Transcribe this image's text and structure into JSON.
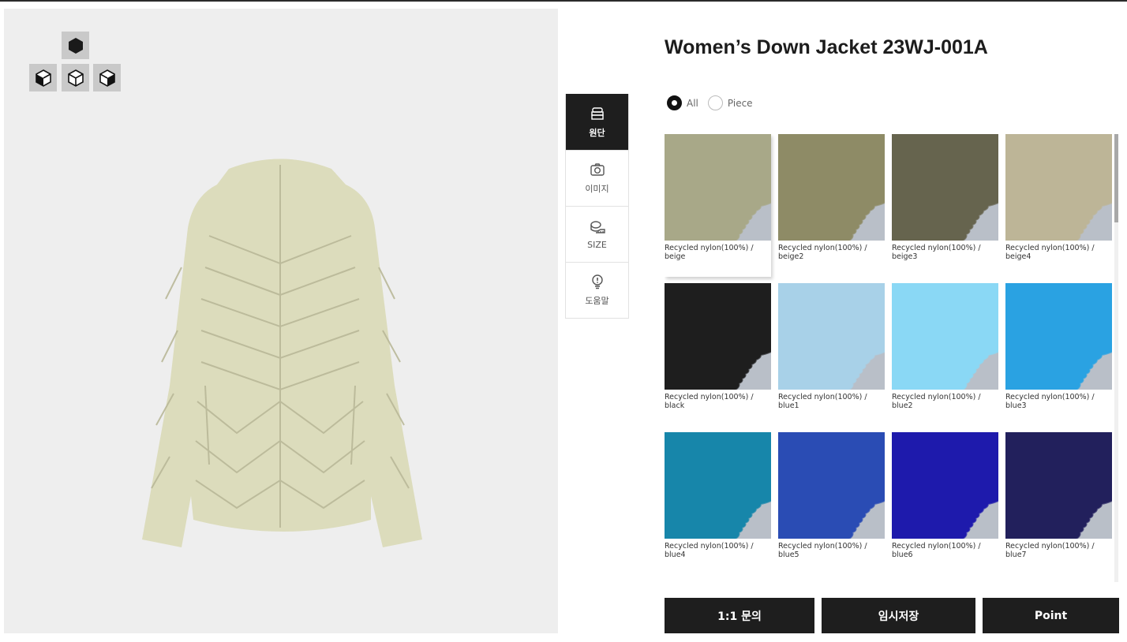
{
  "product": {
    "title": "Women’s Down Jacket 23WJ-001A"
  },
  "viewer": {
    "view_buttons": [
      {
        "name": "view-top-icon"
      },
      {
        "name": "view-left-icon"
      },
      {
        "name": "view-front-icon"
      },
      {
        "name": "view-right-icon"
      }
    ],
    "garment_color": "#dcdcbc"
  },
  "side_tabs": [
    {
      "label": "원단",
      "icon": "fabric-icon",
      "active": true
    },
    {
      "label": "이미지",
      "icon": "camera-icon",
      "active": false
    },
    {
      "label": "SIZE",
      "icon": "tape-measure-icon",
      "active": false
    },
    {
      "label": "도움말",
      "icon": "lightbulb-icon",
      "active": false
    }
  ],
  "filter": {
    "options": [
      {
        "label": "All",
        "checked": true
      },
      {
        "label": "Piece",
        "checked": false
      }
    ]
  },
  "fabrics": [
    {
      "label": "Recycled nylon(100%) / beige",
      "color": "#a8a888",
      "selected": true
    },
    {
      "label": "Recycled nylon(100%) / beige2",
      "color": "#8e8b66",
      "selected": false
    },
    {
      "label": "Recycled nylon(100%) / beige3",
      "color": "#66644e",
      "selected": false
    },
    {
      "label": "Recycled nylon(100%) / beige4",
      "color": "#bdb597",
      "selected": false
    },
    {
      "label": "Recycled nylon(100%) / black",
      "color": "#1e1e1e",
      "selected": false
    },
    {
      "label": "Recycled nylon(100%) / blue1",
      "color": "#a8d1e8",
      "selected": false
    },
    {
      "label": "Recycled nylon(100%) / blue2",
      "color": "#8ad8f5",
      "selected": false
    },
    {
      "label": "Recycled nylon(100%) / blue3",
      "color": "#2aa2e2",
      "selected": false
    },
    {
      "label": "Recycled nylon(100%) / blue4",
      "color": "#1786aa",
      "selected": false
    },
    {
      "label": "Recycled nylon(100%) / blue5",
      "color": "#2a4cb4",
      "selected": false
    },
    {
      "label": "Recycled nylon(100%) / blue6",
      "color": "#1e1aac",
      "selected": false
    },
    {
      "label": "Recycled nylon(100%) / blue7",
      "color": "#22205c",
      "selected": false
    }
  ],
  "buttons": [
    {
      "label": "1:1 문의",
      "name": "inquiry-button"
    },
    {
      "label": "임시저장",
      "name": "temp-save-button"
    },
    {
      "label": "Point",
      "name": "point-button"
    }
  ]
}
